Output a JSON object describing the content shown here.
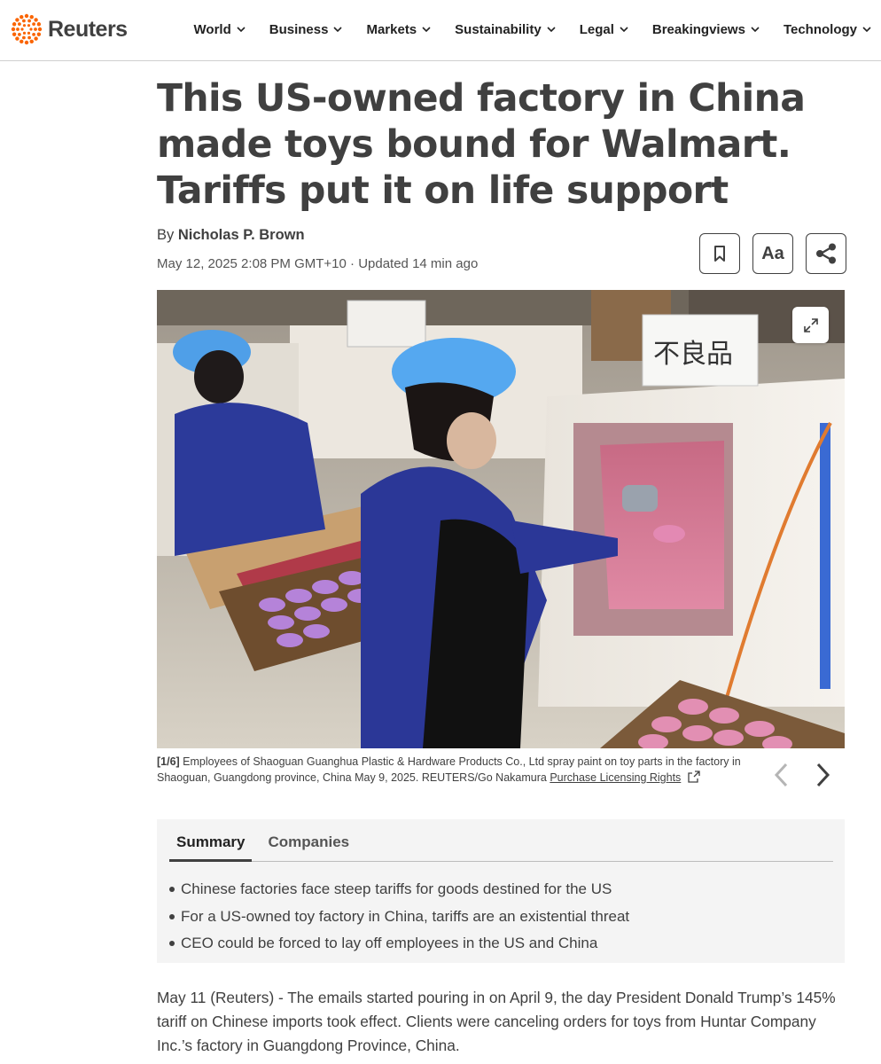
{
  "brand": {
    "name": "Reuters",
    "accent": "#fa6400"
  },
  "nav": {
    "items": [
      {
        "label": "World"
      },
      {
        "label": "Business"
      },
      {
        "label": "Markets"
      },
      {
        "label": "Sustainability"
      },
      {
        "label": "Legal"
      },
      {
        "label": "Breakingviews"
      },
      {
        "label": "Technology"
      }
    ]
  },
  "article": {
    "headline": "This US-owned factory in China made toys bound for Walmart. Tariffs put it on life support",
    "byline_prefix": "By ",
    "author": "Nicholas P. Brown",
    "dateline": "May 12, 2025 2:08 PM GMT+10 · Updated 14 min ago",
    "tools": {
      "bookmark_icon": "bookmark-icon",
      "text_size_label": "Aa",
      "share_icon": "share-icon"
    }
  },
  "gallery": {
    "index": "[1/6]",
    "caption": " Employees of Shaoguan Guanghua Plastic & Hardware Products Co., Ltd spray paint on toy parts in the factory in Shaoguan, Guangdong province, China May 9, 2025. REUTERS/Go Nakamura ",
    "license_link": "Purchase Licensing Rights",
    "sign_text": "不良品"
  },
  "summary": {
    "tabs": [
      {
        "label": "Summary",
        "active": true
      },
      {
        "label": "Companies",
        "active": false
      }
    ],
    "bullets": [
      "Chinese factories face steep tariffs for goods destined for the US",
      "For a US-owned toy factory in China, tariffs are an existential threat",
      "CEO could be forced to lay off employees in the US and China"
    ]
  },
  "body": {
    "paragraph": "May 11 (Reuters) - The emails started pouring in on April 9, the day President Donald Trump’s 145% tariff on Chinese imports took effect. Clients were canceling orders for toys from Huntar Company Inc.’s factory in Guangdong Province, China."
  }
}
